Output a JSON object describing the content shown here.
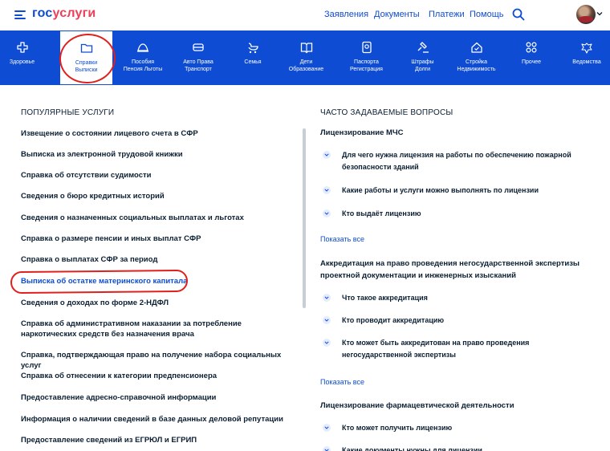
{
  "header": {
    "logo_part1": "гос",
    "logo_part2": "услуги",
    "nav": [
      "Заявления",
      "Документы",
      "Платежи",
      "Помощь"
    ]
  },
  "categories": [
    {
      "label1": "Здоровье",
      "label2": "",
      "icon": "plus-cross-icon"
    },
    {
      "label1": "Справки",
      "label2": "Выписки",
      "icon": "folder-icon"
    },
    {
      "label1": "Пособия",
      "label2": "Пенсия Льготы",
      "icon": "support-icon"
    },
    {
      "label1": "Авто Права",
      "label2": "Транспорт",
      "icon": "car-icon"
    },
    {
      "label1": "Семья",
      "label2": "",
      "icon": "stroller-icon"
    },
    {
      "label1": "Дети",
      "label2": "Образование",
      "icon": "book-icon"
    },
    {
      "label1": "Паспорта",
      "label2": "Регистрация",
      "icon": "passport-icon"
    },
    {
      "label1": "Штрафы",
      "label2": "Долги",
      "icon": "gavel-icon"
    },
    {
      "label1": "Стройка",
      "label2": "Недвижимость",
      "icon": "house-icon"
    },
    {
      "label1": "Прочее",
      "label2": "",
      "icon": "grid-icon"
    },
    {
      "label1": "Ведомства",
      "label2": "",
      "icon": "eagle-icon"
    }
  ],
  "popular": {
    "title": "ПОПУЛЯРНЫЕ УСЛУГИ",
    "items": [
      "Извещение о состоянии лицевого счета в СФР",
      "Выписка из электронной трудовой книжки",
      "Справка об отсутствии судимости",
      "Сведения о бюро кредитных историй",
      "Сведения о назначенных социальных выплатах и льготах",
      "Справка о размере пенсии и иных выплат СФР",
      "Справка о выплатах СФР за период",
      "Выписка об остатке материнского капитала",
      "Сведения о доходах по форме 2-НДФЛ",
      "Справка об административном наказании за потребление наркотических средств без назначения врача",
      "Справка, подтверждающая право на получение набора социальных услуг",
      "Справка об отнесении к категории предпенсионера",
      "Предоставление адресно-справочной информации",
      "Информация о наличии сведений в базе данных деловой репутации",
      "Предоставление сведений из ЕГРЮЛ и ЕГРИП"
    ]
  },
  "faq": {
    "title": "ЧАСТО ЗАДАВАЕМЫЕ ВОПРОСЫ",
    "show_all": "Показать все",
    "groups": [
      {
        "title": "Лицензирование МЧС",
        "questions": [
          "Для чего нужна лицензия на работы по обеспечению пожарной безопасности зданий",
          "Какие работы и услуги можно выполнять по лицензии",
          "Кто выдаёт лицензию"
        ]
      },
      {
        "title": "Аккредитация на право проведения негосударственной экспертизы проектной документации и инженерных изысканий",
        "questions": [
          "Что такое аккредитация",
          "Кто проводит аккредитацию",
          "Кто может быть аккредитован на право проведения негосударственной экспертизы"
        ]
      },
      {
        "title": "Лицензирование фармацевтической деятельности",
        "questions": [
          "Кто может получить лицензию",
          "Какие документы нужны для лицензии"
        ]
      }
    ]
  },
  "colors": {
    "brand_blue": "#0d4cd3",
    "brand_red": "#ee3f58",
    "annotation_red": "#e1201c"
  }
}
